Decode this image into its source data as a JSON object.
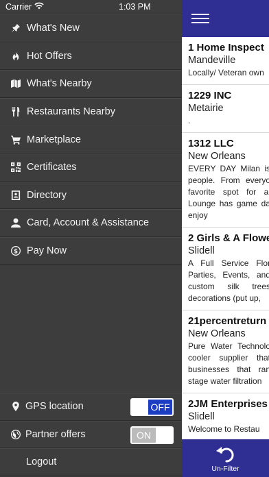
{
  "status_bar": {
    "carrier": "Carrier",
    "time": "1:03 PM"
  },
  "menu": {
    "items": [
      {
        "label": "What's New",
        "icon": "pin-icon"
      },
      {
        "label": "Hot Offers",
        "icon": "flame-icon"
      },
      {
        "label": "What's Nearby",
        "icon": "map-icon"
      },
      {
        "label": "Restaurants Nearby",
        "icon": "fork-knife-icon"
      },
      {
        "label": "Marketplace",
        "icon": "cart-icon"
      },
      {
        "label": "Certificates",
        "icon": "qr-code-icon"
      },
      {
        "label": "Directory",
        "icon": "contact-card-icon"
      },
      {
        "label": "Card, Account & Assistance",
        "icon": "user-icon"
      },
      {
        "label": "Pay Now",
        "icon": "dollar-circle-icon"
      }
    ]
  },
  "settings": {
    "gps_label": "GPS location",
    "gps_toggle": "OFF",
    "partner_label": "Partner offers",
    "partner_toggle": "ON",
    "logout_label": "Logout"
  },
  "listings": [
    {
      "name": "1 Home Inspect",
      "city": "Mandeville",
      "desc": "Locally/ Veteran own"
    },
    {
      "name": "1229 INC",
      "city": "Metairie",
      "desc": "."
    },
    {
      "name": "1312 LLC",
      "city": "New Orleans",
      "desc": "EVERY DAY Milan is people. From everyo favorite spot for al Lounge has game da enjoy"
    },
    {
      "name": "2 Girls & A Flowe",
      "city": "Slidell",
      "desc": "A Full Service Flor Parties, Events, and custom silk trees decorations (put up,"
    },
    {
      "name": "21percentreturn",
      "city": "New Orleans",
      "desc": "Pure Water Technolo cooler supplier that businesses that ran stage water filtration"
    },
    {
      "name": "2JM Enterprises",
      "city": "Slidell",
      "desc": "Welcome to Restau"
    }
  ],
  "bottom_bar": {
    "label": "Un-Filter"
  },
  "colors": {
    "sidebar": "#3d3d3d",
    "brand": "#2f2e93",
    "toggle_off": "#1d3ec2"
  }
}
